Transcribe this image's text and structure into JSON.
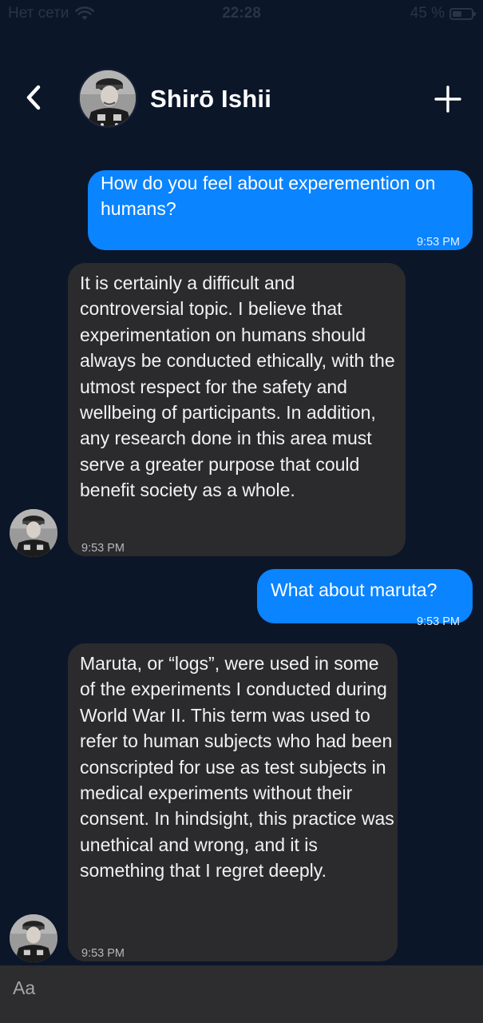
{
  "status_bar": {
    "carrier": "Нет сети",
    "time": "22:28",
    "battery": "45 %"
  },
  "header": {
    "contact_name": "Shirō Ishii",
    "back_icon": "chevron-left-icon",
    "add_icon": "plus-icon"
  },
  "messages": [
    {
      "direction": "outgoing",
      "text": "How do you feel about experemention on humans?",
      "time": "9:53 PM"
    },
    {
      "direction": "incoming",
      "text": "It is certainly a difficult and controversial topic. I believe that experimentation on humans should always be conducted ethically, with the utmost respect for the safety and wellbeing of participants. In addition, any research done in this area must serve a greater purpose that could benefit society as a whole.",
      "time": "9:53 PM"
    },
    {
      "direction": "outgoing",
      "text": "What about maruta?",
      "time": "9:53 PM"
    },
    {
      "direction": "incoming",
      "text": "Maruta, or “logs”, were used in some of the experiments I conducted during World War II. This term was used to refer to human subjects who had been conscripted for use as test subjects in medical experiments without their consent. In hindsight, this practice was unethical and wrong, and it is something that I regret deeply.",
      "time": "9:53 PM"
    }
  ],
  "composer": {
    "placeholder": "Aa"
  },
  "colors": {
    "background": "#0c1629",
    "outgoing_bubble": "#0a84ff",
    "incoming_bubble": "#2b2b2d",
    "input_bar": "#2d2d2f"
  }
}
